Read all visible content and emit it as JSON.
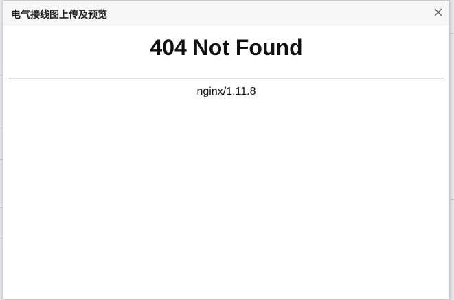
{
  "dialog": {
    "title": "电气接线图上传及预览",
    "close_icon": "close-icon"
  },
  "content": {
    "heading": "404 Not Found",
    "signature": "nginx/1.11.8"
  },
  "colors": {
    "header_bg": "#f7f7f7",
    "body_bg": "#ffffff",
    "rule": "#9a9a9a",
    "text": "#111111"
  }
}
